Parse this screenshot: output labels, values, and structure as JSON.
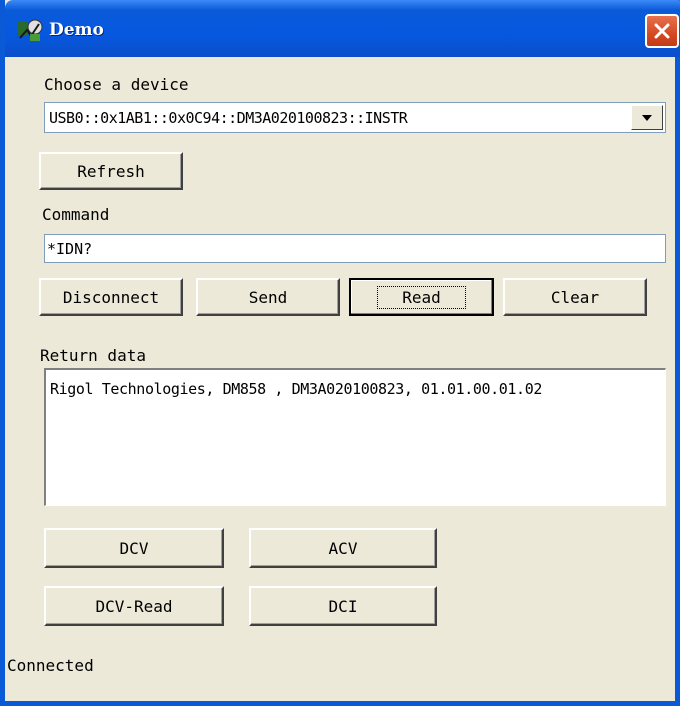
{
  "window": {
    "title": "Demo"
  },
  "device": {
    "label": "Choose a device",
    "selected": "USB0::0x1AB1::0x0C94::DM3A020100823::INSTR"
  },
  "buttons": {
    "refresh": "Refresh",
    "disconnect": "Disconnect",
    "send": "Send",
    "read": "Read",
    "clear": "Clear",
    "dcv": "DCV",
    "acv": "ACV",
    "dcv_read": "DCV-Read",
    "dci": "DCI"
  },
  "command": {
    "label": "Command",
    "value": "*IDN?"
  },
  "return_data": {
    "label": "Return data",
    "value": "Rigol Technologies, DM858 , DM3A020100823, 01.01.00.01.02"
  },
  "status": {
    "text": "Connected"
  },
  "colors": {
    "titlebar": "#0a5ad8",
    "window_bg": "#ece9d8",
    "close_button": "#d44a22"
  },
  "icons": {
    "app": "app-icon",
    "close": "close-icon",
    "dropdown": "chevron-down-icon"
  }
}
